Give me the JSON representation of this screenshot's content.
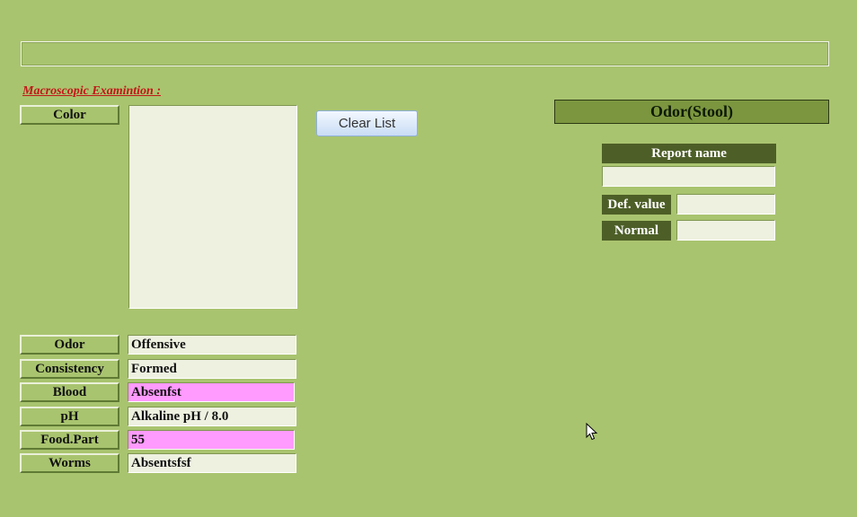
{
  "top_bar": {
    "value": ""
  },
  "section": {
    "title": "Macroscopic Examintion :"
  },
  "color": {
    "label": "Color",
    "items": []
  },
  "fields": {
    "odor": {
      "label": "Odor",
      "value": "Offensive"
    },
    "consistency": {
      "label": "Consistency",
      "value": "Formed"
    },
    "blood": {
      "label": "Blood",
      "value": "Absenfst",
      "highlight": "#ff9aff"
    },
    "ph": {
      "label": "pH",
      "value": "Alkaline pH / 8.0"
    },
    "food_part": {
      "label": "Food.Part",
      "value": "55",
      "highlight": "#ff9aff"
    },
    "worms": {
      "label": "Worms",
      "value": "Absentsfsf"
    }
  },
  "clear_button": {
    "label": "Clear List"
  },
  "panel": {
    "title": "Odor(Stool)",
    "report_name_label": "Report name",
    "report_name_value": "",
    "def_value_label": "Def. value",
    "def_value": "",
    "normal_label": "Normal",
    "normal_value": ""
  },
  "colors": {
    "background": "#a9c46f",
    "panel_header": "#7b963f",
    "dark_label": "#4d5f27",
    "section_title": "#c01818",
    "highlight": "#ff9aff"
  },
  "icons": {
    "cursor": "mouse-pointer-icon"
  }
}
